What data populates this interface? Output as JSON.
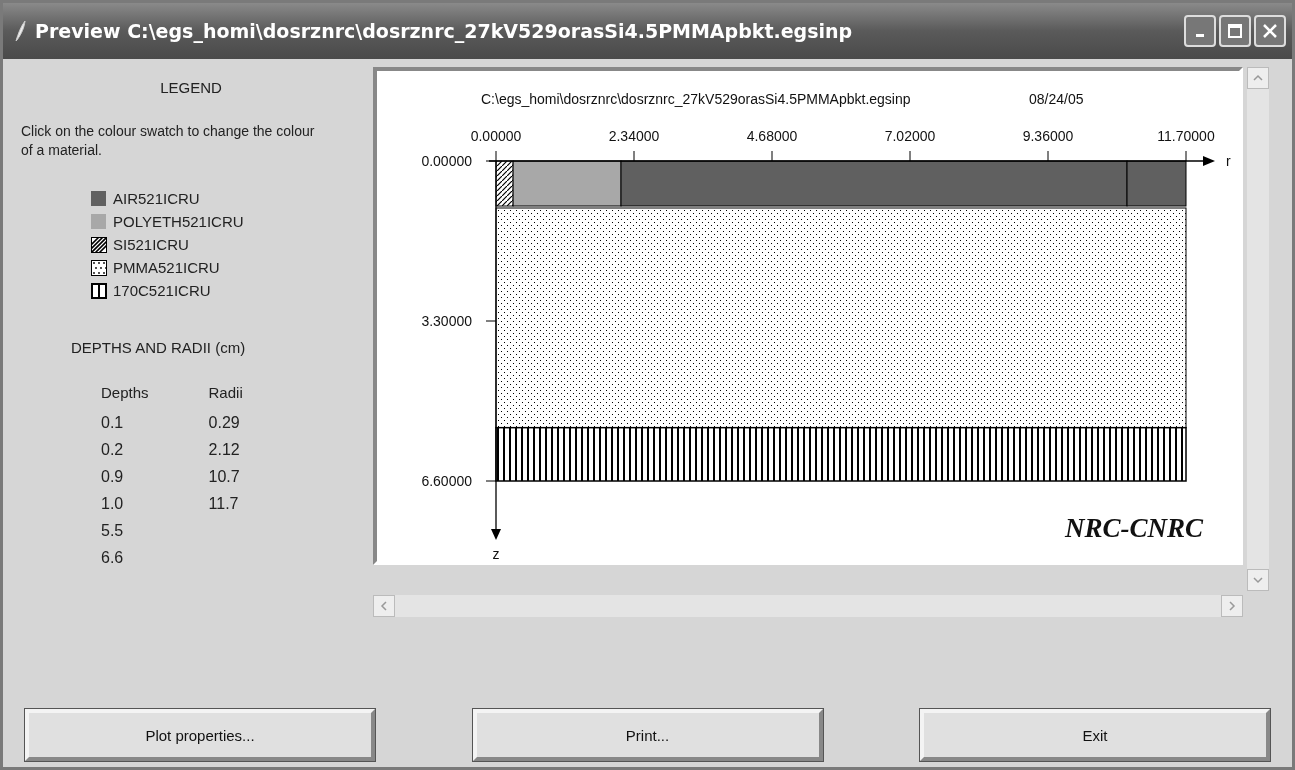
{
  "window": {
    "title": "Preview C:\\egs_homi\\dosrznrc\\dosrznrc_27kV529orasSi4.5PMMApbkt.egsinp"
  },
  "legend": {
    "heading": "LEGEND",
    "hint": "Click on the colour swatch to change the colour of a material.",
    "materials": [
      {
        "name": "AIR521ICRU",
        "kind": "solid",
        "color": "#606060"
      },
      {
        "name": "POLYETH521ICRU",
        "kind": "solid",
        "color": "#a8a8a8"
      },
      {
        "name": "SI521ICRU",
        "kind": "hatch"
      },
      {
        "name": "PMMA521ICRU",
        "kind": "dots"
      },
      {
        "name": "170C521ICRU",
        "kind": "stripes"
      }
    ]
  },
  "dimensions": {
    "heading": "DEPTHS AND RADII (cm)",
    "depths_label": "Depths",
    "radii_label": "Radii",
    "depths": [
      "0.1",
      "0.2",
      "0.9",
      "1.0",
      "5.5",
      "6.6"
    ],
    "radii": [
      "0.29",
      "2.12",
      "10.7",
      "11.7"
    ]
  },
  "plot": {
    "title": "C:\\egs_homi\\dosrznrc\\dosrznrc_27kV529orasSi4.5PMMApbkt.egsinp",
    "date": "08/24/05",
    "r_ticks": [
      "0.00000",
      "2.34000",
      "4.68000",
      "7.02000",
      "9.36000",
      "11.70000"
    ],
    "r_label": "r",
    "z_ticks": [
      "0.00000",
      "3.30000",
      "6.60000"
    ],
    "z_label": "z",
    "credit": "NRC-CNRC"
  },
  "buttons": [
    "Plot properties...",
    "Print...",
    "Exit"
  ]
}
